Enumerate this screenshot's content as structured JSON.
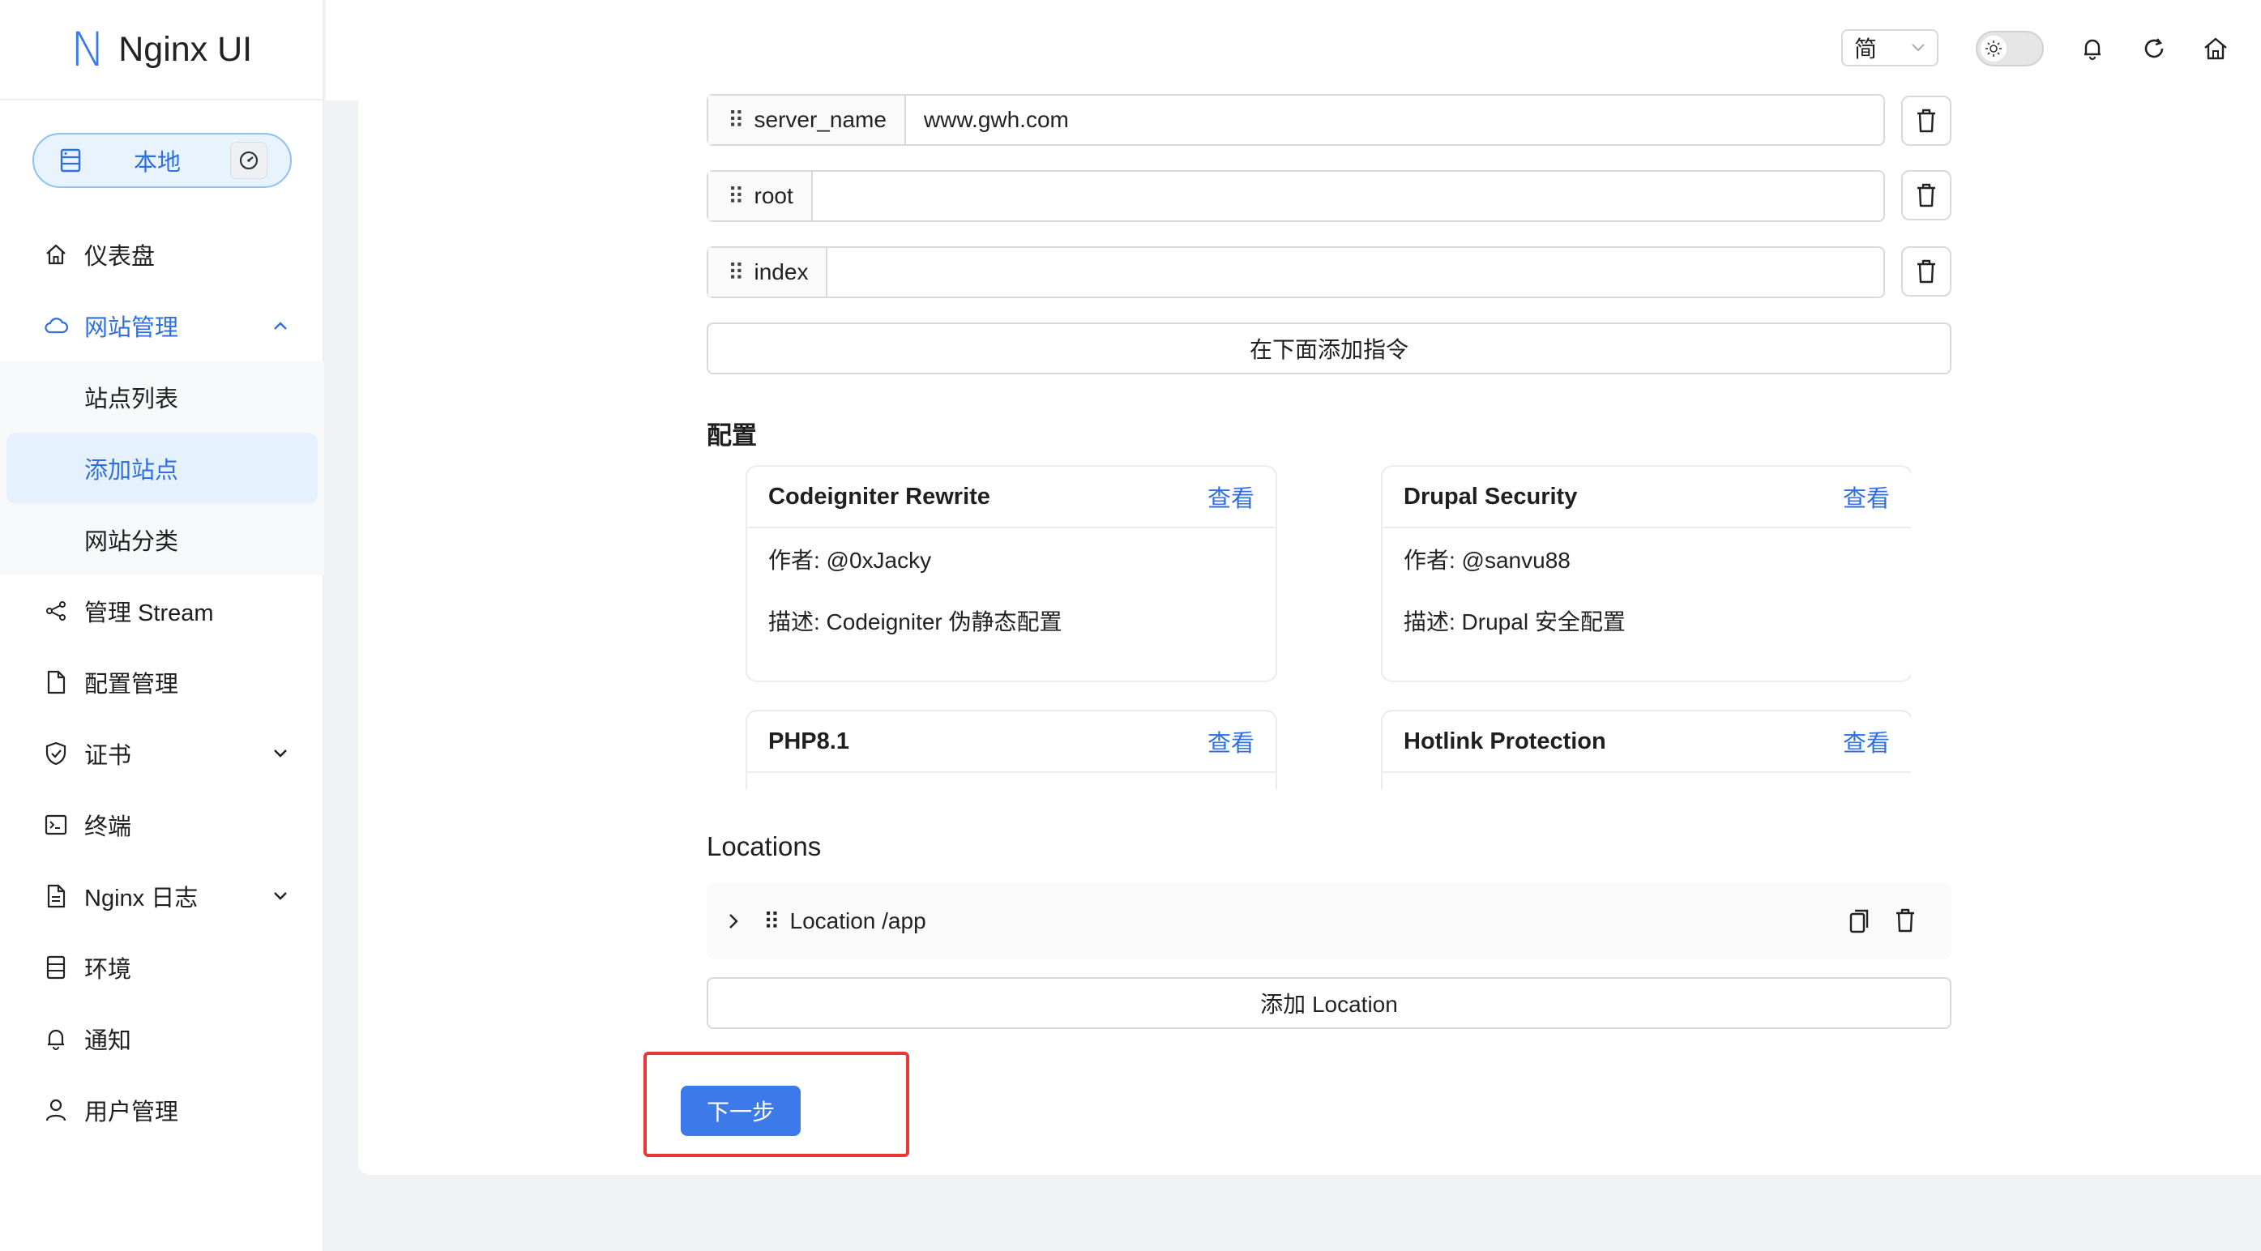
{
  "app": {
    "logo_mark": "N",
    "title": "Nginx UI"
  },
  "node": {
    "label": "本地"
  },
  "sidebar": {
    "items": [
      {
        "label": "仪表盘"
      },
      {
        "label": "网站管理"
      },
      {
        "label": "站点列表"
      },
      {
        "label": "添加站点"
      },
      {
        "label": "网站分类"
      },
      {
        "label": "管理 Stream"
      },
      {
        "label": "配置管理"
      },
      {
        "label": "证书"
      },
      {
        "label": "终端"
      },
      {
        "label": "Nginx 日志"
      },
      {
        "label": "环境"
      },
      {
        "label": "通知"
      },
      {
        "label": "用户管理"
      }
    ]
  },
  "header": {
    "language": "简"
  },
  "directives": [
    {
      "name": "server_name",
      "value": "www.gwh.com"
    },
    {
      "name": "root",
      "value": ""
    },
    {
      "name": "index",
      "value": ""
    }
  ],
  "add_directive_label": "在下面添加指令",
  "config_section": {
    "title": "配置",
    "view_label": "查看",
    "author_prefix": "作者: ",
    "desc_prefix": "描述: ",
    "cards": [
      {
        "title": "Codeigniter Rewrite",
        "author": "作者: @0xJacky",
        "description": "描述: Codeigniter 伪静态配置"
      },
      {
        "title": "Drupal Security",
        "author": "作者: @sanvu88",
        "description": "描述: Drupal 安全配置"
      },
      {
        "title": "PHP8.1",
        "author": "",
        "description": ""
      },
      {
        "title": "Hotlink Protection",
        "author": "",
        "description": ""
      }
    ]
  },
  "locations": {
    "title": "Locations",
    "items": [
      {
        "label": "Location /app"
      }
    ],
    "add_label": "添加 Location"
  },
  "next_button": "下一步",
  "colors": {
    "accent": "#3b7ae8",
    "highlight": "#e53935",
    "active_bg": "#e6f1fe"
  }
}
